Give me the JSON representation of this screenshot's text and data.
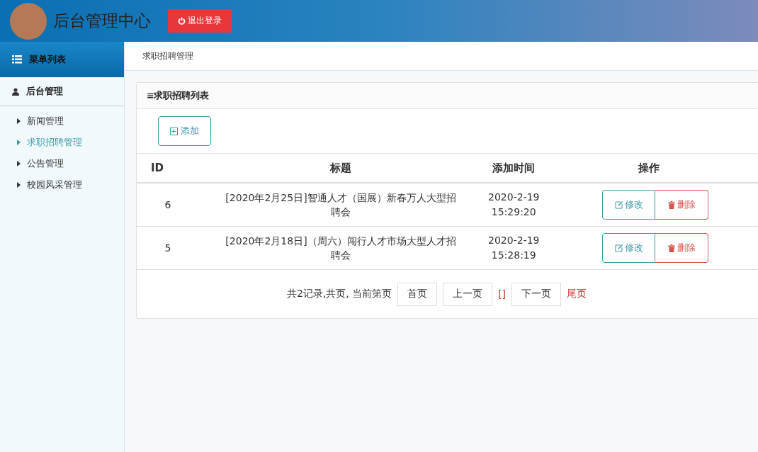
{
  "header": {
    "title": "后台管理中心",
    "logout": "退出登录"
  },
  "sidebar": {
    "heading": "菜单列表",
    "group": "后台管理",
    "items": [
      {
        "label": "新闻管理",
        "selected": false
      },
      {
        "label": "求职招聘管理",
        "selected": true
      },
      {
        "label": "公告管理",
        "selected": false
      },
      {
        "label": "校园风采管理",
        "selected": false
      }
    ]
  },
  "breadcrumb": "求职招聘管理",
  "panel": {
    "title": "≡求职招聘列表",
    "add_button": "添加",
    "table": {
      "columns": [
        "ID",
        "标题",
        "添加时间",
        "操作"
      ],
      "rows": [
        {
          "id": "6",
          "title": "[2020年2月25日]智通人才（国展）新春万人大型招聘会",
          "time": [
            "2020-2-19",
            "15:29:20"
          ],
          "edit": "修改",
          "delete": "删除"
        },
        {
          "id": "5",
          "title": "[2020年2月18日]（周六）闯行人才市场大型人才招聘会",
          "time": [
            "2020-2-19",
            "15:28:19"
          ],
          "edit": "修改",
          "delete": "删除"
        }
      ]
    },
    "pagination": {
      "info": "共2记录,共页, 当前第页",
      "items": [
        {
          "kind": "button",
          "label": "首页"
        },
        {
          "kind": "button",
          "label": "上一页"
        },
        {
          "kind": "link",
          "label": "[]"
        },
        {
          "kind": "button",
          "label": "下一页"
        },
        {
          "kind": "link",
          "label": "尾页"
        }
      ]
    }
  }
}
